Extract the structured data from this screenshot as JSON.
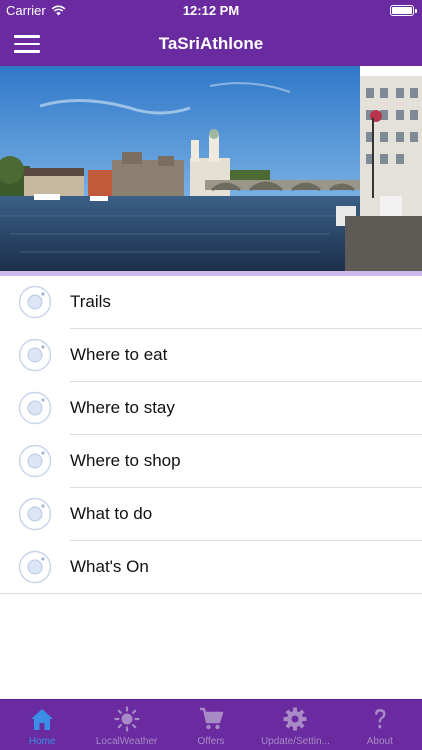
{
  "status_bar": {
    "carrier": "Carrier",
    "time": "12:12 PM"
  },
  "nav": {
    "title": "TaSriAthlone"
  },
  "hero": {
    "image": "athlone-castle-river-shannon-photo"
  },
  "menu": [
    {
      "label": "Trails"
    },
    {
      "label": "Where to eat"
    },
    {
      "label": "Where to stay"
    },
    {
      "label": "Where to shop"
    },
    {
      "label": "What to do"
    },
    {
      "label": "What's On"
    }
  ],
  "tabs": [
    {
      "label": "Home",
      "icon": "home-icon",
      "active": true
    },
    {
      "label": "LocalWeather",
      "icon": "sun-icon",
      "active": false
    },
    {
      "label": "Offers",
      "icon": "cart-icon",
      "active": false
    },
    {
      "label": "Update/Settin...",
      "icon": "gear-icon",
      "active": false
    },
    {
      "label": "About",
      "icon": "question-icon",
      "active": false
    }
  ],
  "colors": {
    "brand_purple": "#6a2aa0",
    "tab_active": "#3a8ee8",
    "tab_inactive": "#a88ac6",
    "divider": "#cdb8ec"
  }
}
